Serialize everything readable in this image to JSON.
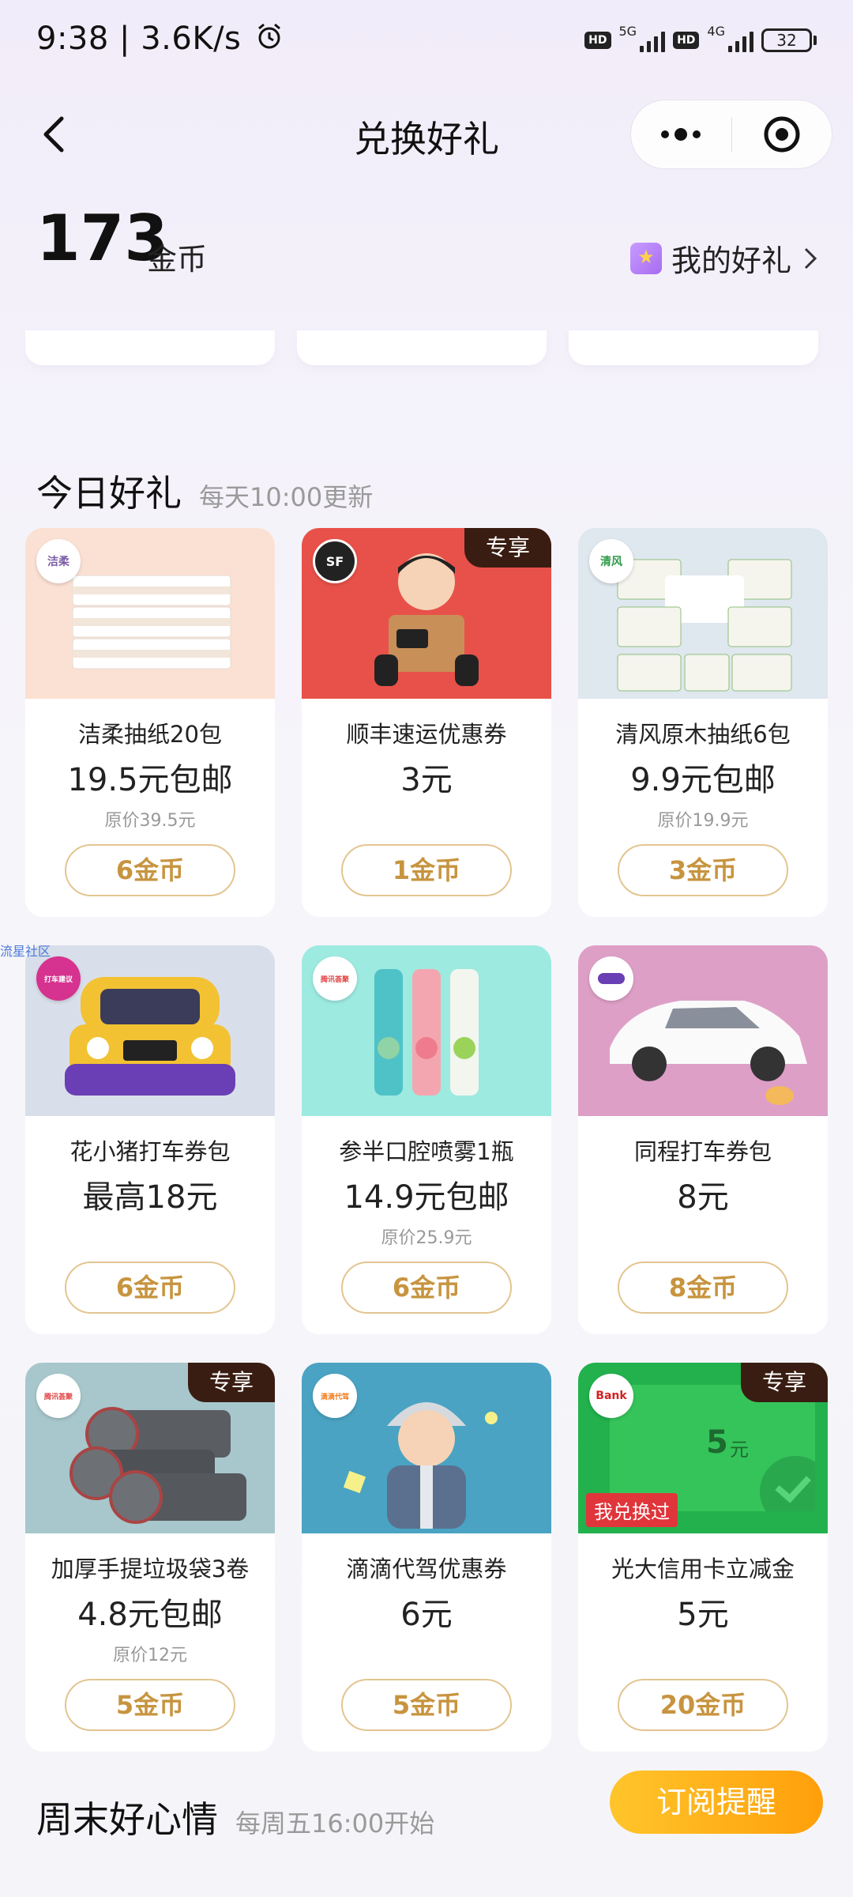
{
  "status_bar": {
    "time": "9:38",
    "speed": "3.6K/s",
    "hd_label": "HD",
    "net_5g": "5G",
    "net_4g": "4G",
    "battery": "32"
  },
  "nav": {
    "title": "兑换好礼",
    "menu_icon": "more-dots-icon",
    "close_icon": "target-circle-icon"
  },
  "coins": {
    "amount": "173",
    "unit": "金币",
    "my_gifts_label": "我的好礼"
  },
  "today_section": {
    "title": "今日好礼",
    "subtitle": "每天10:00更新"
  },
  "side_label": "流星社区",
  "products": [
    {
      "name": "洁柔抽纸20包",
      "price": "19.5元包邮",
      "orig": "原价39.5元",
      "cost": "6金币",
      "exclusive": "",
      "brand": "洁柔",
      "img_color": "#fbe1d3"
    },
    {
      "name": "顺丰速运优惠券",
      "price": "3元",
      "orig": "",
      "cost": "1金币",
      "exclusive": "专享",
      "brand": "SF",
      "img_color": "#e8514a"
    },
    {
      "name": "清风原木抽纸6包",
      "price": "9.9元包邮",
      "orig": "原价19.9元",
      "cost": "3金币",
      "exclusive": "",
      "brand": "清风",
      "img_color": "#dfe7ef"
    },
    {
      "name": "花小猪打车券包",
      "price": "最高18元",
      "orig": "",
      "cost": "6金币",
      "exclusive": "",
      "brand": "打车建议",
      "img_color": "#d9dfea"
    },
    {
      "name": "参半口腔喷雾1瓶",
      "price": "14.9元包邮",
      "orig": "原价25.9元",
      "cost": "6金币",
      "exclusive": "",
      "brand": "腾讯荟聚",
      "img_color": "#9deae0"
    },
    {
      "name": "同程打车券包",
      "price": "8元",
      "orig": "",
      "cost": "8金币",
      "exclusive": "",
      "brand": "",
      "img_color": "#de9fc7"
    },
    {
      "name": "加厚手提垃圾袋3卷",
      "price": "4.8元包邮",
      "orig": "原价12元",
      "cost": "5金币",
      "exclusive": "专享",
      "brand": "腾讯荟聚",
      "img_color": "#a7c7cc"
    },
    {
      "name": "滴滴代驾优惠券",
      "price": "6元",
      "orig": "",
      "cost": "5金币",
      "exclusive": "",
      "brand": "滴滴代驾",
      "img_color": "#4aa3c2"
    },
    {
      "name": "光大信用卡立减金",
      "price": "5元",
      "orig": "",
      "cost": "20金币",
      "exclusive": "专享",
      "brand": "Bank",
      "img_color": "#22b14c",
      "card_amount": "5",
      "card_unit": "元",
      "card_tag": "我兑换过"
    }
  ],
  "weekend_section": {
    "title": "周末好心情",
    "subtitle": "每周五16:00开始",
    "subscribe_label": "订阅提醒"
  }
}
